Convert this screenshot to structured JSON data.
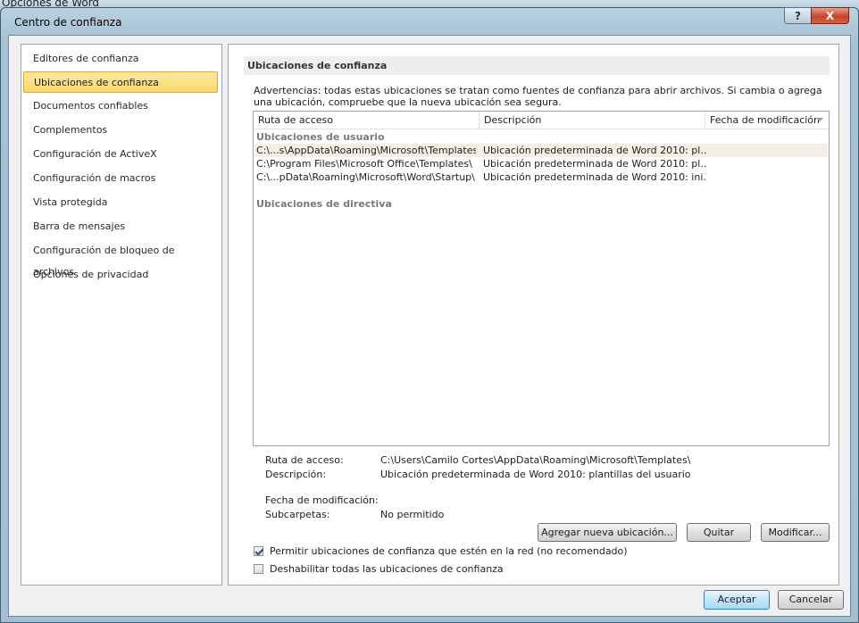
{
  "background_window": {
    "title": "Opciones de Word"
  },
  "dialog": {
    "title": "Centro de confianza",
    "help_label": "?",
    "close_label": "X"
  },
  "nav": {
    "items": [
      {
        "label": "Editores de confianza",
        "active": false
      },
      {
        "label": "Ubicaciones de confianza",
        "active": true
      },
      {
        "label": "Documentos confiables",
        "active": false
      },
      {
        "label": "Complementos",
        "active": false
      },
      {
        "label": "Configuración de ActiveX",
        "active": false
      },
      {
        "label": "Configuración de macros",
        "active": false
      },
      {
        "label": "Vista protegida",
        "active": false
      },
      {
        "label": "Barra de mensajes",
        "active": false
      },
      {
        "label": "Configuración de bloqueo de archivos",
        "active": false
      },
      {
        "label": "Opciones de privacidad",
        "active": false
      }
    ]
  },
  "panel": {
    "section_title": "Ubicaciones de confianza",
    "warning": "Advertencias: todas estas ubicaciones se tratan como fuentes de confianza para abrir archivos. Si cambia o agrega una ubicación, compruebe que la nueva ubicación sea segura.",
    "columns": [
      "Ruta de acceso",
      "Descripción",
      "Fecha de modificación"
    ],
    "user_group_label": "Ubicaciones de usuario",
    "user_rows": [
      {
        "path": "C:\\...s\\AppData\\Roaming\\Microsoft\\Templates\\",
        "description": "Ubicación predeterminada de Word 2010: pl...",
        "date": ""
      },
      {
        "path": "C:\\Program Files\\Microsoft Office\\Templates\\",
        "description": "Ubicación predeterminada de Word 2010: pl...",
        "date": ""
      },
      {
        "path": "C:\\...pData\\Roaming\\Microsoft\\Word\\Startup\\",
        "description": "Ubicación predeterminada de Word 2010: ini...",
        "date": ""
      }
    ],
    "policy_group_label": "Ubicaciones de directiva",
    "details": {
      "path_label": "Ruta de acceso:",
      "path_value": "C:\\Users\\Camilo Cortes\\AppData\\Roaming\\Microsoft\\Templates\\",
      "desc_label": "Descripción:",
      "desc_value": "Ubicación predeterminada de Word 2010: plantillas del usuario",
      "date_label": "Fecha de modificación:",
      "date_value": "",
      "subfolders_label": "Subcarpetas:",
      "subfolders_value": "No permitido"
    },
    "buttons": {
      "add": "Agregar nueva ubicación...",
      "remove": "Quitar",
      "modify": "Modificar..."
    },
    "checkboxes": {
      "allow_network": {
        "label": "Permitir ubicaciones de confianza que estén en la red (no recomendado)",
        "checked": true
      },
      "disable_all": {
        "label": "Deshabilitar todas las ubicaciones de confianza",
        "checked": false
      }
    }
  },
  "footer": {
    "ok": "Aceptar",
    "cancel": "Cancelar"
  }
}
